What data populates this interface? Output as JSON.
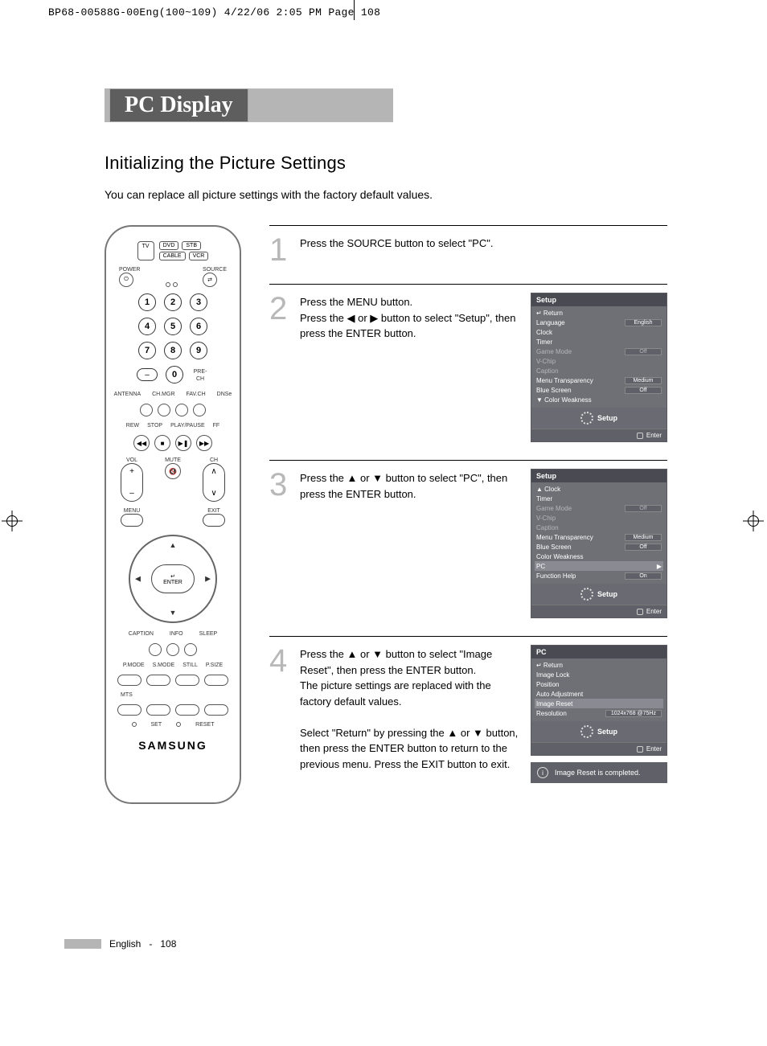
{
  "print_header": "BP68-00588G-00Eng(100~109)  4/22/06  2:05 PM  Page 108",
  "section_title": "PC Display",
  "subtitle": "Initializing the Picture Settings",
  "intro": "You can replace all picture settings with the factory default values.",
  "remote": {
    "tv": "TV",
    "dvd": "DVD",
    "stb": "STB",
    "cable": "CABLE",
    "vcr": "VCR",
    "power": "POWER",
    "source": "SOURCE",
    "antenna": "ANTENNA",
    "chmgr": "CH.MGR",
    "favch": "FAV.CH",
    "dnse": "DNSe",
    "rew": "REW",
    "stop": "STOP",
    "play": "PLAY/PAUSE",
    "ff": "FF",
    "vol": "VOL",
    "ch": "CH",
    "mute": "MUTE",
    "prech": "PRE-CH",
    "menu": "MENU",
    "exit": "EXIT",
    "enter": "ENTER",
    "caption": "CAPTION",
    "info": "INFO",
    "sleep": "SLEEP",
    "pmode": "P.MODE",
    "smode": "S.MODE",
    "still": "STILL",
    "psize": "P.SIZE",
    "mts": "MTS",
    "set": "SET",
    "reset": "RESET",
    "brand": "SAMSUNG"
  },
  "steps": [
    {
      "n": "1",
      "text": "Press the SOURCE button to select \"PC\"."
    },
    {
      "n": "2",
      "text": "Press the MENU button.\nPress the ◀ or ▶ button to select \"Setup\", then press the ENTER button."
    },
    {
      "n": "3",
      "text": "Press the ▲ or ▼ button to select \"PC\", then press the ENTER button."
    },
    {
      "n": "4",
      "text": "Press the ▲ or ▼ button to select \"Image Reset\", then press the ENTER button.\nThe picture settings are replaced with the factory default values.\n\nSelect \"Return\" by pressing the ▲ or ▼ button, then press the ENTER button to return to the previous menu. Press the EXIT button to exit."
    }
  ],
  "osd1": {
    "title": "Setup",
    "footer_label": "Setup",
    "enter": "Enter",
    "rows": [
      {
        "label": "Return",
        "prefix": "↵",
        "hl": false
      },
      {
        "label": "Language",
        "val": "English"
      },
      {
        "label": "Clock"
      },
      {
        "label": "Timer"
      },
      {
        "label": "Game Mode",
        "val": "Off",
        "dim": true
      },
      {
        "label": "V-Chip",
        "dim": true
      },
      {
        "label": "Caption",
        "dim": true
      },
      {
        "label": "Menu Transparency",
        "val": "Medium"
      },
      {
        "label": "Blue Screen",
        "val": "Off"
      },
      {
        "label": "Color Weakness",
        "prefix": "▼"
      }
    ]
  },
  "osd2": {
    "title": "Setup",
    "footer_label": "Setup",
    "enter": "Enter",
    "rows": [
      {
        "label": "Clock",
        "prefix": "▲"
      },
      {
        "label": "Timer"
      },
      {
        "label": "Game Mode",
        "val": "Off",
        "dim": true
      },
      {
        "label": "V-Chip",
        "dim": true
      },
      {
        "label": "Caption",
        "dim": true
      },
      {
        "label": "Menu Transparency",
        "val": "Medium"
      },
      {
        "label": "Blue Screen",
        "val": "Off"
      },
      {
        "label": "Color Weakness"
      },
      {
        "label": "PC",
        "hl": true,
        "suffix": "▶"
      },
      {
        "label": "Function Help",
        "val": "On"
      }
    ]
  },
  "osd3": {
    "title": "PC",
    "footer_label": "Setup",
    "enter": "Enter",
    "rows": [
      {
        "label": "Return",
        "prefix": "↵"
      },
      {
        "label": "Image Lock"
      },
      {
        "label": "Position"
      },
      {
        "label": "Auto Adjustment"
      },
      {
        "label": "Image Reset",
        "hl": true
      },
      {
        "label": "Resolution",
        "val": "1024x768 @75Hz"
      }
    ],
    "toast": "Image Reset is completed."
  },
  "footer": {
    "lang": "English",
    "page": "108"
  }
}
